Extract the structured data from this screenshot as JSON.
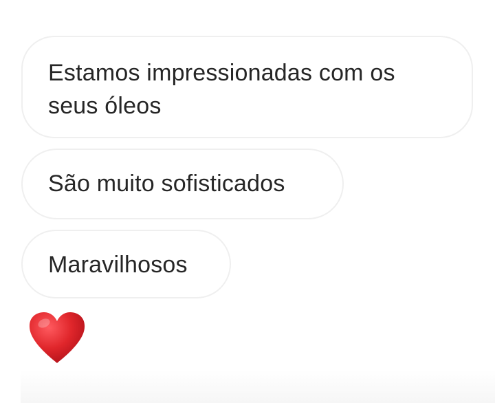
{
  "messages": [
    {
      "text": "Estamos impressionadas com os seus óleos"
    },
    {
      "text": "São muito sofisticados"
    },
    {
      "text": "Maravilhosos"
    }
  ],
  "reaction": {
    "icon": "red-heart-icon",
    "color": "#e0262b"
  }
}
